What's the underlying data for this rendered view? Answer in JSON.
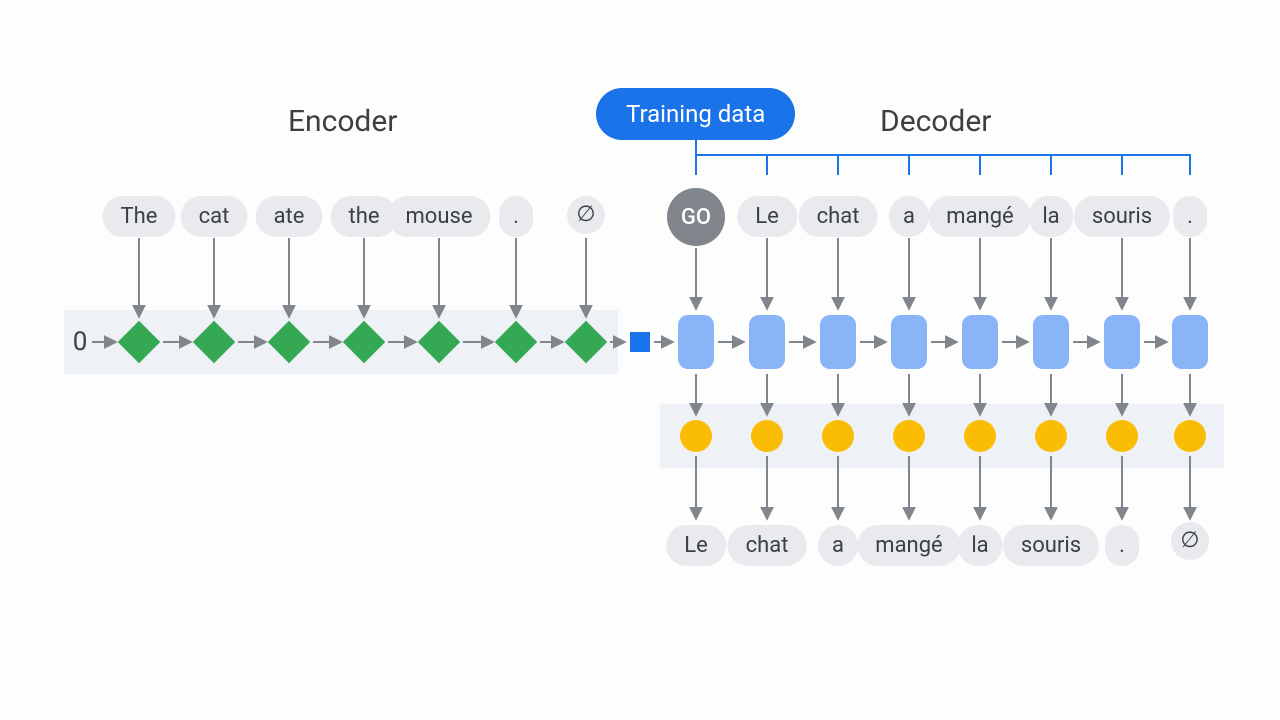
{
  "titles": {
    "encoder": "Encoder",
    "decoder": "Decoder",
    "training_data": "Training data"
  },
  "encoder": {
    "start_label": "0",
    "input_tokens": [
      "The",
      "cat",
      "ate",
      "the",
      "mouse",
      ".",
      "∅"
    ]
  },
  "decoder": {
    "input_tokens": [
      "GO",
      "Le",
      "chat",
      "a",
      "mangé",
      "la",
      "souris",
      "."
    ],
    "output_tokens": [
      "Le",
      "chat",
      "a",
      "mangé",
      "la",
      "souris",
      ".",
      "∅"
    ]
  }
}
